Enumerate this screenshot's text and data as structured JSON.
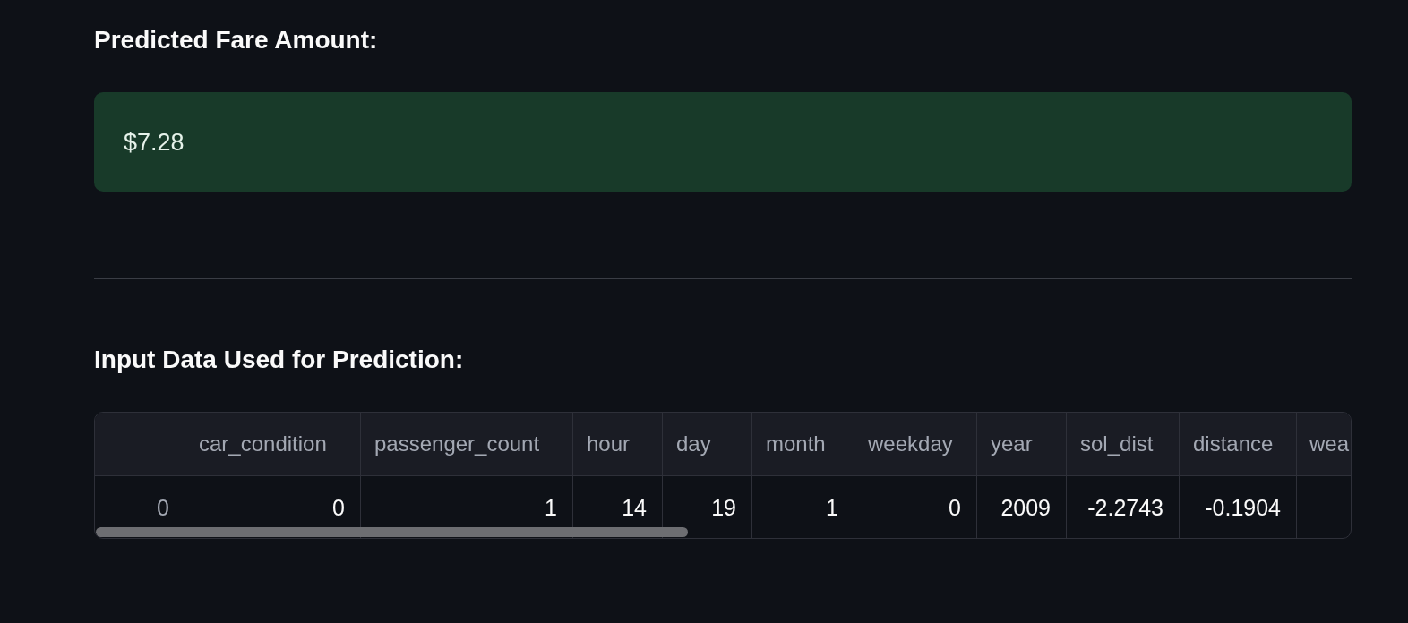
{
  "fare_section": {
    "heading": "Predicted Fare Amount:",
    "result": "$7.28"
  },
  "input_section": {
    "heading": "Input Data Used for Prediction:",
    "table": {
      "columns": [
        "car_condition",
        "passenger_count",
        "hour",
        "day",
        "month",
        "weekday",
        "year",
        "sol_dist",
        "distance",
        "wea"
      ],
      "rows": [
        {
          "index": "0",
          "values": [
            "0",
            "1",
            "14",
            "19",
            "1",
            "0",
            "2009",
            "-2.2743",
            "-0.1904"
          ]
        }
      ]
    }
  }
}
